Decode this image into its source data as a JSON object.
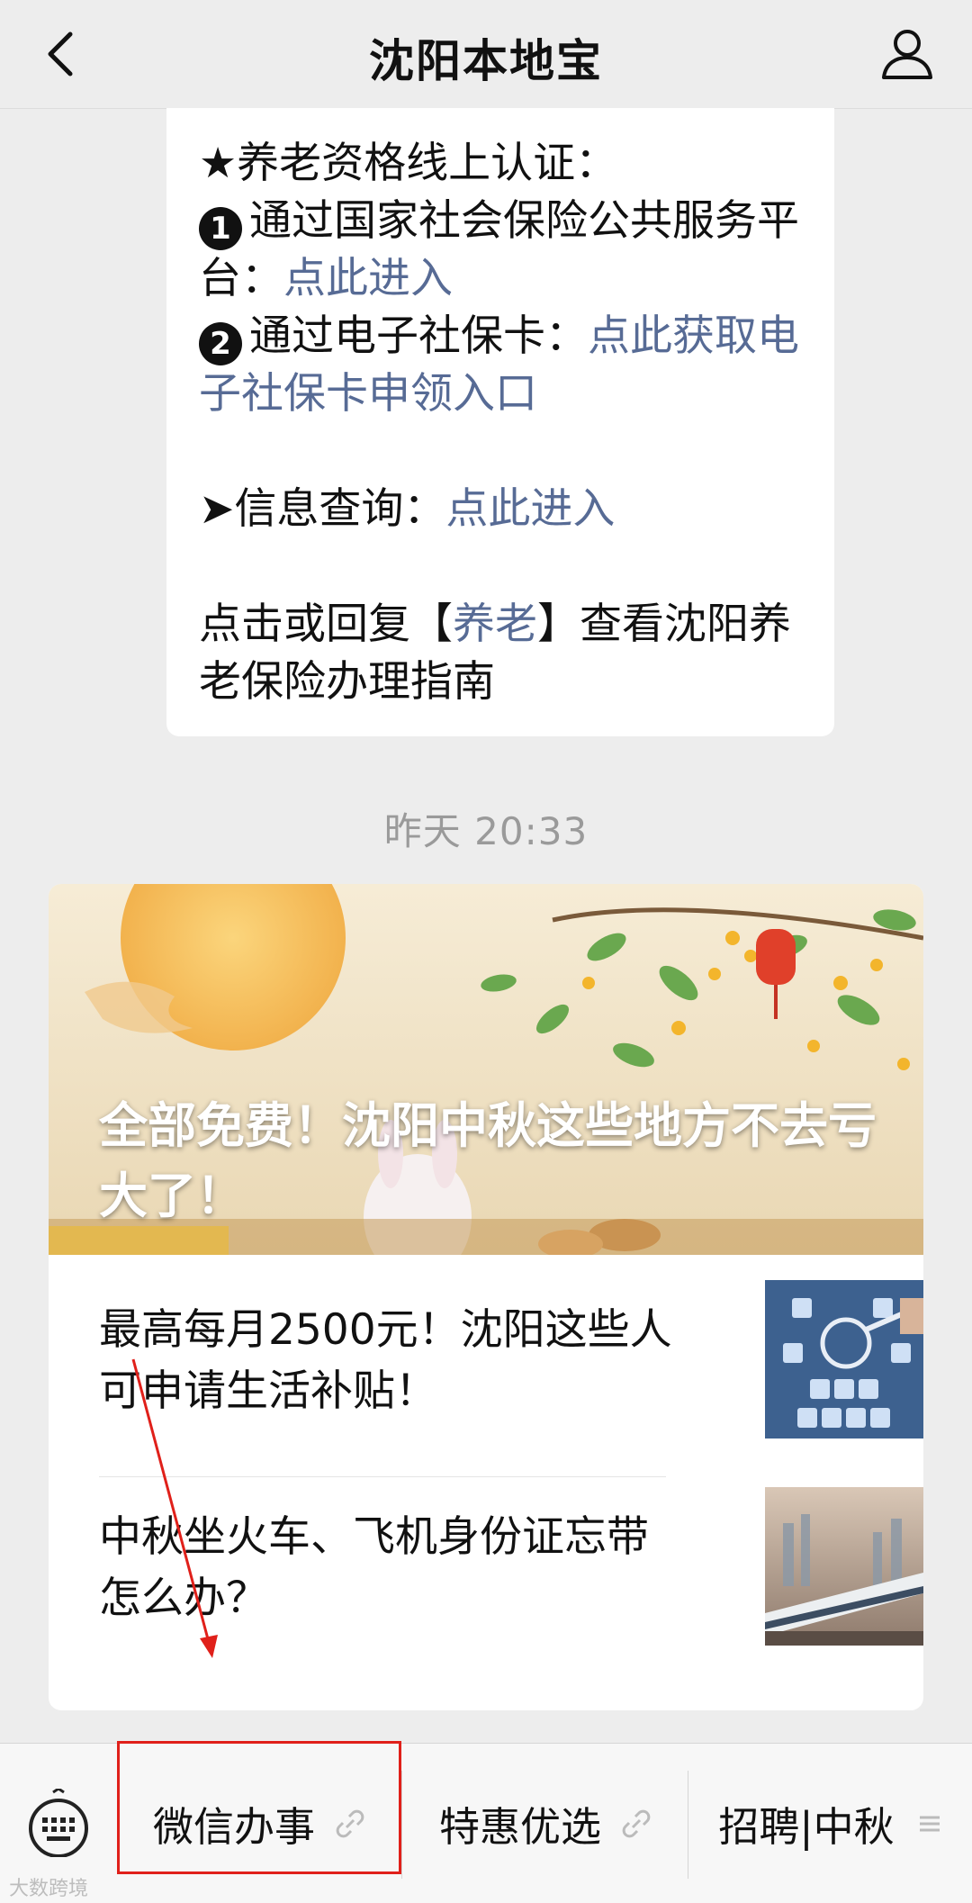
{
  "header": {
    "title": "沈阳本地宝",
    "back_icon": "chevron-left-icon",
    "profile_icon": "user-icon"
  },
  "message": {
    "line1": "★养老资格线上认证：",
    "item1_badge": "❶",
    "item1_text": "通过国家社会保险公共服务平台：",
    "item1_link": "点此进入",
    "item2_badge": "❷",
    "item2_text": "通过电子社保卡：",
    "item2_link": "点此获取电子社保卡申领入口",
    "query_prefix": "➤信息查询：",
    "query_link": "点此进入",
    "guide_prefix": "点击或回复【",
    "guide_keyword": "养老",
    "guide_suffix": "】查看沈阳养老保险办理指南"
  },
  "timestamp": "昨天 20:33",
  "article": {
    "cover_title": "全部免费！沈阳中秋这些地方不去亏大了！",
    "items": [
      {
        "title": "最高每月2500元！沈阳这些人可申请生活补贴！"
      },
      {
        "title": "中秋坐火车、飞机身份证忘带怎么办？"
      }
    ]
  },
  "bottom_menu": {
    "keyboard_icon": "keyboard-icon",
    "items": [
      {
        "label": "微信办事",
        "icon": "link-icon"
      },
      {
        "label": "特惠优选",
        "icon": "link-icon"
      },
      {
        "label": "招聘|中秋",
        "icon": "menu-lines-icon"
      }
    ]
  },
  "watermark": "大数跨境",
  "colors": {
    "link": "#576b95",
    "highlight": "#e0201a",
    "background": "#ededed"
  }
}
